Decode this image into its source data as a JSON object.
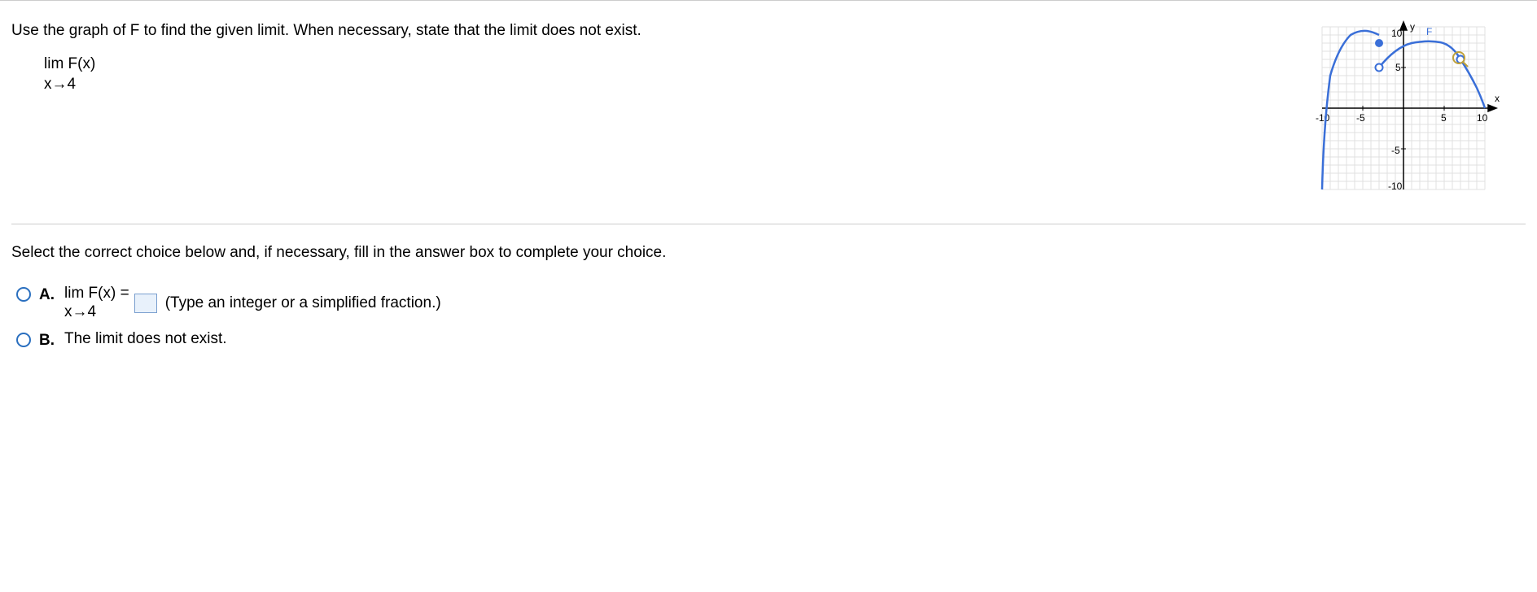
{
  "question": {
    "prompt": "Use the graph of F to find the given limit. When necessary, state that the limit does not exist.",
    "limit_top": "lim F(x)",
    "limit_bot": "x→4"
  },
  "graph": {
    "function_label": "F",
    "x_label": "x",
    "y_label": "y",
    "ticks": {
      "x_neg10": "-10",
      "x_neg5": "-5",
      "x_5": "5",
      "x_10": "10",
      "y_10": "10",
      "y_5": "5",
      "y_neg5": "-5",
      "y_neg10": "-10"
    }
  },
  "choices_intro": "Select the correct choice below and, if necessary, fill in the answer box to complete your choice.",
  "choice_a": {
    "label": "A.",
    "lim_top": "lim F(x) =",
    "lim_bot": "x→4",
    "hint": "(Type an integer or a simplified fraction.)"
  },
  "choice_b": {
    "label": "B.",
    "text": "The limit does not exist."
  },
  "chart_data": {
    "type": "line",
    "title": "",
    "xlabel": "x",
    "ylabel": "y",
    "xlim": [
      -10,
      10
    ],
    "ylim": [
      -10,
      10
    ],
    "series": [
      {
        "name": "F",
        "segments": [
          {
            "x": [
              -10,
              -9.5,
              -9,
              -8,
              -7,
              -6,
              -5,
              -4,
              -3
            ],
            "y": [
              -10,
              0,
              4,
              7.5,
              9,
              9.5,
              9.5,
              9.3,
              9
            ]
          },
          {
            "x": [
              -3,
              -2,
              -1,
              0,
              1,
              2,
              3,
              4,
              4.5,
              5,
              6,
              7,
              8,
              9,
              10
            ],
            "y": [
              5,
              6.5,
              7.5,
              8,
              8.3,
              8.4,
              8.3,
              8.1,
              8,
              7.7,
              7,
              6,
              4.5,
              2.5,
              0
            ]
          }
        ]
      }
    ],
    "points": [
      {
        "x": -3,
        "y": 8,
        "type": "closed"
      },
      {
        "x": -3,
        "y": 5,
        "type": "open"
      },
      {
        "x": 7,
        "y": 6,
        "type": "open"
      }
    ]
  }
}
